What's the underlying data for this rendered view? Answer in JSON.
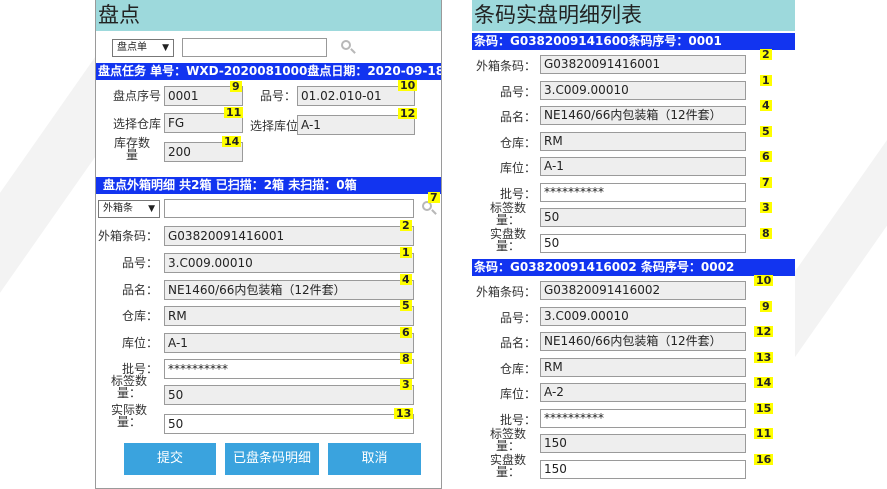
{
  "stock_panel": {
    "title": "盘点",
    "filter": {
      "select_label": "盘点单",
      "input_value": ""
    },
    "task_bar": "盘点任务   单号：WXD-2020081000盘点日期：2020-09-18",
    "fields": {
      "seq_label": "盘点序号",
      "seq_value": "0001",
      "seq_badge": "9",
      "item_label": "品号：",
      "item_value": "01.02.010-01",
      "item_badge": "10",
      "warehouse_label": "选择仓库",
      "warehouse_value": "FG",
      "warehouse_badge": "11",
      "location_label": "选择库位",
      "location_value": "A-1",
      "location_badge": "12",
      "qty_label": "库存数量",
      "qty_value": "200",
      "qty_badge": "14"
    },
    "box_bar": "盘点外箱明细  共2箱 已扫描：2箱 未扫描：0箱",
    "box_filter": {
      "select_label": "外箱条",
      "input_value": "",
      "badge": "7"
    },
    "box_fields": [
      {
        "label": "外箱条码：",
        "value": "G03820091416001",
        "badge": "2"
      },
      {
        "label": "品号：",
        "value": "3.C009.00010",
        "badge": "1"
      },
      {
        "label": "品名：",
        "value": "NE1460/66内包装箱（12件套）",
        "badge": "4"
      },
      {
        "label": "仓库：",
        "value": "RM",
        "badge": "5"
      },
      {
        "label": "库位：",
        "value": "A-1",
        "badge": "6"
      },
      {
        "label": "批号：",
        "value": "**********",
        "badge": "8"
      },
      {
        "label": "标签数量：",
        "value": "50",
        "badge": "3"
      },
      {
        "label": "实际数量：",
        "value": "50",
        "badge": "13"
      }
    ],
    "buttons": {
      "submit": "提交",
      "detail": "已盘条码明细",
      "cancel": "取消"
    }
  },
  "detail_panel": {
    "title": "条码实盘明细列表",
    "records": [
      {
        "header": "条码：G0382009141600条码序号：0001",
        "fields": [
          {
            "label": "外箱条码：",
            "value": "G03820091416001",
            "badge": "2"
          },
          {
            "label": "品号：",
            "value": "3.C009.00010",
            "badge": "1"
          },
          {
            "label": "品名：",
            "value": "NE1460/66内包装箱（12件套）",
            "badge": "4"
          },
          {
            "label": "仓库：",
            "value": "RM",
            "badge": "5"
          },
          {
            "label": "库位：",
            "value": "A-1",
            "badge": "6"
          },
          {
            "label": "批号：",
            "value": "**********",
            "badge": "7"
          },
          {
            "label": "标签数量：",
            "value": "50",
            "badge": "3"
          },
          {
            "label": "实盘数量：",
            "value": "50",
            "badge": "8"
          }
        ]
      },
      {
        "header": "条码：G03820091416002 条码序号：0002",
        "fields": [
          {
            "label": "外箱条码：",
            "value": "G03820091416002",
            "badge": "10"
          },
          {
            "label": "品号：",
            "value": "3.C009.00010",
            "badge": "9"
          },
          {
            "label": "品名：",
            "value": "NE1460/66内包装箱（12件套）",
            "badge": "12"
          },
          {
            "label": "仓库：",
            "value": "RM",
            "badge": "13"
          },
          {
            "label": "库位：",
            "value": "A-2",
            "badge": "14"
          },
          {
            "label": "批号：",
            "value": "**********",
            "badge": "15"
          },
          {
            "label": "标签数量：",
            "value": "150",
            "badge": "11"
          },
          {
            "label": "实盘数量：",
            "value": "150",
            "badge": "16"
          }
        ]
      }
    ]
  }
}
